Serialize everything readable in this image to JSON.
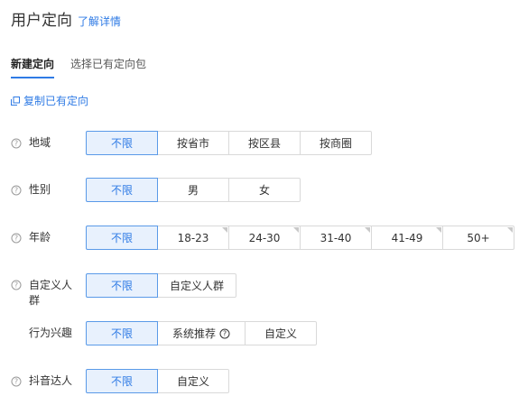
{
  "header": {
    "title": "用户定向",
    "learn_more": "了解详情"
  },
  "tabs": [
    {
      "label": "新建定向"
    },
    {
      "label": "选择已有定向包"
    }
  ],
  "copy_existing": "复制已有定向",
  "rows": {
    "region": {
      "label": "地域",
      "options": [
        "不限",
        "按省市",
        "按区县",
        "按商圈"
      ]
    },
    "gender": {
      "label": "性别",
      "options": [
        "不限",
        "男",
        "女"
      ]
    },
    "age": {
      "label": "年龄",
      "options": [
        "不限",
        "18-23",
        "24-30",
        "31-40",
        "41-49",
        "50+"
      ]
    },
    "custom_crowd": {
      "label": "自定义人群",
      "options": [
        "不限",
        "自定义人群"
      ]
    },
    "interest": {
      "label": "行为兴趣",
      "options": [
        "不限",
        "系统推荐",
        "自定义"
      ]
    },
    "douyin": {
      "label": "抖音达人",
      "options": [
        "不限",
        "自定义"
      ]
    }
  },
  "colors": {
    "accent": "#2f7be5",
    "selected_bg": "#e8f1fd",
    "border": "#d9d9d9"
  }
}
